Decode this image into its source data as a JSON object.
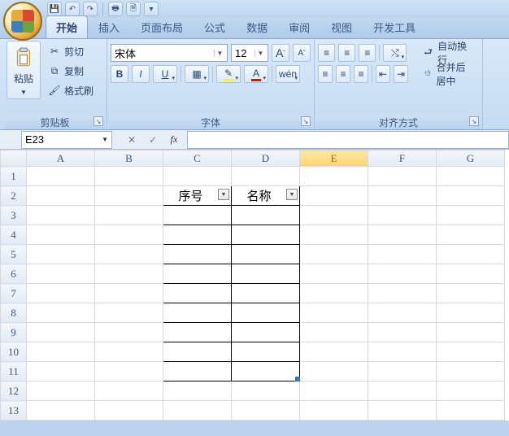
{
  "qat": {
    "save": "💾",
    "undo": "↶",
    "redo": "↷",
    "print": "🖶",
    "preview": "🗎"
  },
  "tabs": [
    "开始",
    "插入",
    "页面布局",
    "公式",
    "数据",
    "审阅",
    "视图",
    "开发工具"
  ],
  "active_tab": 0,
  "ribbon": {
    "clipboard": {
      "title": "剪贴板",
      "paste": "粘贴",
      "cut": "剪切",
      "copy": "复制",
      "format_painter": "格式刷"
    },
    "font": {
      "title": "字体",
      "name": "宋体",
      "size": "12",
      "bold": "B",
      "italic": "I",
      "underline": "U"
    },
    "align": {
      "title": "对齐方式",
      "wrap": "自动换行",
      "merge": "合并后居中"
    }
  },
  "namebox": "E23",
  "formula": "",
  "columns": [
    "A",
    "B",
    "C",
    "D",
    "E",
    "F",
    "G"
  ],
  "rows": [
    1,
    2,
    3,
    4,
    5,
    6,
    7,
    8,
    9,
    10,
    11,
    12,
    13
  ],
  "selected_col": "E",
  "table": {
    "col_start": 2,
    "row_start": 1,
    "row_end": 10,
    "headers": [
      "序号",
      "名称"
    ]
  }
}
